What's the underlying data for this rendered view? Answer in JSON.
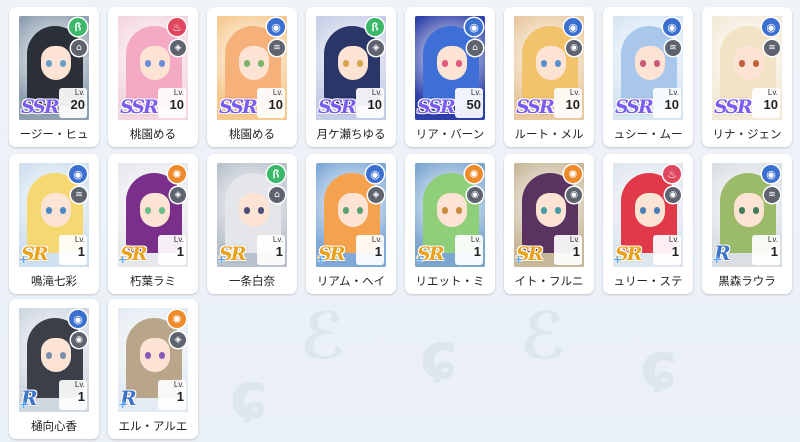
{
  "colors": {
    "background": "#eef3f8",
    "ssr_frame": "#b9a9ff",
    "sr_frame": "#f4a04a",
    "r_frame": "#86b6e6"
  },
  "characters": [
    {
      "name": "ージー・ヒュ",
      "rarity_label": "SSR",
      "rarity": "ssr",
      "lv_label": "Lv.",
      "level": "20",
      "element": "green",
      "element_icon": "leaf-swirl-icon",
      "role_icon": "armor-icon",
      "hair": "#2b3038",
      "eye": "#6aa0c8",
      "bg": "#8e9fb0"
    },
    {
      "name": "桃園める",
      "rarity_label": "SSR",
      "rarity": "ssr",
      "lv_label": "Lv.",
      "level": "10",
      "element": "red",
      "element_icon": "flame-icon",
      "role_icon": "shield-icon",
      "hair": "#f4a9c4",
      "eye": "#6a8bd9",
      "bg": "#f3d6df"
    },
    {
      "name": "桃園める",
      "rarity_label": "SSR",
      "rarity": "ssr",
      "lv_label": "Lv.",
      "level": "10",
      "element": "blue",
      "element_icon": "water-icon",
      "role_icon": "wing-icon",
      "hair": "#f6b07a",
      "eye": "#7bb36b",
      "bg": "#f6c98f"
    },
    {
      "name": "月ケ瀬ちゆる",
      "rarity_label": "SSR",
      "rarity": "ssr",
      "lv_label": "Lv.",
      "level": "10",
      "element": "green",
      "element_icon": "leaf-swirl-icon",
      "role_icon": "shield-icon",
      "hair": "#2a3568",
      "eye": "#d9a54b",
      "bg": "#c6cde6"
    },
    {
      "name": "リア・バーン",
      "rarity_label": "SSR",
      "rarity": "ssr",
      "lv_label": "Lv.",
      "level": "50",
      "element": "blue",
      "element_icon": "water-icon",
      "role_icon": "armor-icon",
      "hair": "#3e6fd6",
      "eye": "#e05a7c",
      "bg": "#2d3fa8"
    },
    {
      "name": "ルート・メル",
      "rarity_label": "SSR",
      "rarity": "ssr",
      "lv_label": "Lv.",
      "level": "10",
      "element": "blue",
      "element_icon": "water-icon",
      "role_icon": "eye-icon",
      "hair": "#f2c36b",
      "eye": "#5a8fd0",
      "bg": "#e8c9a0"
    },
    {
      "name": "ュシー・ムー",
      "rarity_label": "SSR",
      "rarity": "ssr",
      "lv_label": "Lv.",
      "level": "10",
      "element": "blue",
      "element_icon": "water-icon",
      "role_icon": "wing-icon",
      "hair": "#a9c7ea",
      "eye": "#c75a7a",
      "bg": "#d7e6f3"
    },
    {
      "name": "リナ・ジェン",
      "rarity_label": "SSR",
      "rarity": "ssr",
      "lv_label": "Lv.",
      "level": "10",
      "element": "blue",
      "element_icon": "water-icon",
      "role_icon": "wing-icon",
      "hair": "#f2e2c6",
      "eye": "#c0603a",
      "bg": "#f4ead8"
    },
    {
      "name": "鳴滝七彩",
      "rarity_label": "SR",
      "rarity": "sr",
      "lv_label": "Lv.",
      "level": "1",
      "element": "blue",
      "element_icon": "water-icon",
      "role_icon": "wing-icon",
      "hair": "#f5d872",
      "eye": "#4f86c6",
      "bg": "#cfe0f0"
    },
    {
      "name": "朽葉ラミ",
      "rarity_label": "SR",
      "rarity": "sr",
      "lv_label": "Lv.",
      "level": "1",
      "element": "orange",
      "element_icon": "sun-icon",
      "role_icon": "shield-icon",
      "hair": "#7a2f8a",
      "eye": "#6bbf8a",
      "bg": "#e6e8ee"
    },
    {
      "name": "一条白奈",
      "rarity_label": "SR",
      "rarity": "sr",
      "lv_label": "Lv.",
      "level": "1",
      "element": "green",
      "element_icon": "leaf-swirl-icon",
      "role_icon": "armor-icon",
      "hair": "#e4e6ea",
      "eye": "#4a4f7a",
      "bg": "#b9c2cc"
    },
    {
      "name": "リアム・ヘイ",
      "rarity_label": "SR",
      "rarity": "sr",
      "lv_label": "Lv.",
      "level": "1",
      "element": "blue",
      "element_icon": "water-icon",
      "role_icon": "shield-icon",
      "hair": "#f4a24e",
      "eye": "#5aa06a",
      "bg": "#7fa9d8"
    },
    {
      "name": "リエット・ミ",
      "rarity_label": "SR",
      "rarity": "sr",
      "lv_label": "Lv.",
      "level": "1",
      "element": "orange",
      "element_icon": "sun-icon",
      "role_icon": "eye-icon",
      "hair": "#8fcf7a",
      "eye": "#c88a3e",
      "bg": "#7ba6d0"
    },
    {
      "name": "イト・フルニ",
      "rarity_label": "SR",
      "rarity": "sr",
      "lv_label": "Lv.",
      "level": "1",
      "element": "orange",
      "element_icon": "sun-icon",
      "role_icon": "eye-icon",
      "hair": "#5a3360",
      "eye": "#4a9aa6",
      "bg": "#c8b89a"
    },
    {
      "name": "ュリー・ステ",
      "rarity_label": "SR",
      "rarity": "sr",
      "lv_label": "Lv.",
      "level": "1",
      "element": "red",
      "element_icon": "flame-icon",
      "role_icon": "eye-icon",
      "hair": "#e0394a",
      "eye": "#4a7fb5",
      "bg": "#dfe6ee"
    },
    {
      "name": "黒森ラウラ",
      "rarity_label": "R",
      "rarity": "r",
      "lv_label": "Lv.",
      "level": "1",
      "element": "blue",
      "element_icon": "water-icon",
      "role_icon": "wing-icon",
      "hair": "#9bbb6a",
      "eye": "#3f7a5a",
      "bg": "#d9dfe3"
    },
    {
      "name": "樋向心香",
      "rarity_label": "R",
      "rarity": "r",
      "lv_label": "Lv.",
      "level": "1",
      "element": "blue",
      "element_icon": "water-icon",
      "role_icon": "eye-icon",
      "hair": "#3a3f4a",
      "eye": "#7c8fae",
      "bg": "#cfd7e0"
    },
    {
      "name": "エル・アルエ",
      "rarity_label": "R",
      "rarity": "r",
      "lv_label": "Lv.",
      "level": "1",
      "element": "orange",
      "element_icon": "sun-icon",
      "role_icon": "shield-icon",
      "hair": "#b8a58a",
      "eye": "#8a5ab8",
      "bg": "#e4ebf2"
    }
  ]
}
